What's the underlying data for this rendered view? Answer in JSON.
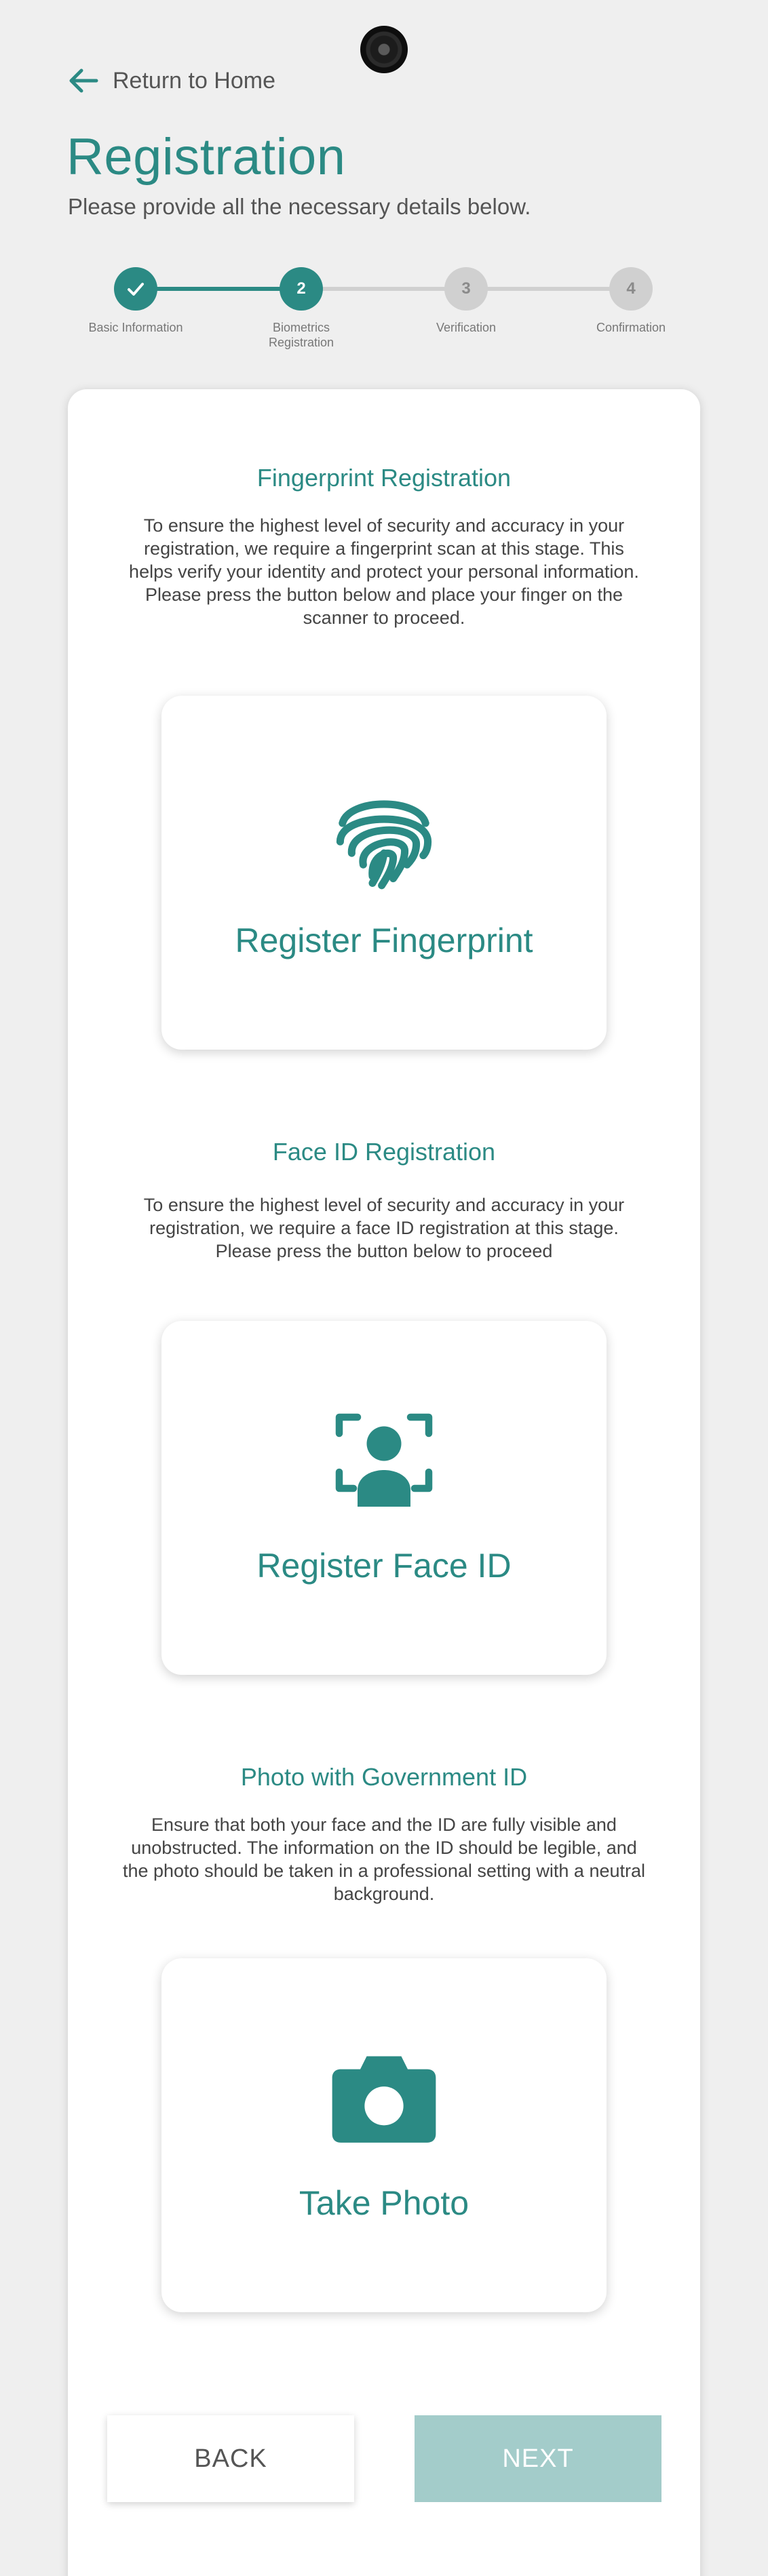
{
  "nav": {
    "back_label": "Return to Home"
  },
  "header": {
    "title": "Registration",
    "subtitle": "Please provide all the necessary details below."
  },
  "stepper": {
    "steps": [
      {
        "number": "",
        "label": "Basic Information",
        "state": "done"
      },
      {
        "number": "2",
        "label": "Biometrics Registration",
        "state": "active"
      },
      {
        "number": "3",
        "label": "Verification",
        "state": "todo"
      },
      {
        "number": "4",
        "label": "Confirmation",
        "state": "todo"
      }
    ]
  },
  "sections": {
    "fingerprint": {
      "title": "Fingerprint Registration",
      "description": "To ensure the highest level of security and accuracy in your registration, we require a fingerprint scan at this stage. This helps verify your identity and protect your personal information. Please press the button below and place your finger on the scanner to proceed.",
      "button_label": "Register Fingerprint",
      "icon": "fingerprint-icon"
    },
    "face_id": {
      "title": "Face ID Registration",
      "description": "To ensure the highest level of security and accuracy in your registration, we require a face ID registration at this stage. Please press the button below to proceed",
      "button_label": "Register Face ID",
      "icon": "face-scan-icon"
    },
    "photo": {
      "title": "Photo with Government ID",
      "description": "Ensure that both your face and the ID are fully visible and unobstructed. The information on the ID should be legible, and the photo should be taken in a professional setting with a neutral background.",
      "button_label": "Take Photo",
      "icon": "camera-icon"
    }
  },
  "footer": {
    "back_label": "BACK",
    "next_label": "NEXT"
  },
  "colors": {
    "accent": "#2b8a84",
    "accent_disabled": "#a3ccca",
    "background": "#efefef",
    "step_inactive": "#d0d0d0"
  }
}
